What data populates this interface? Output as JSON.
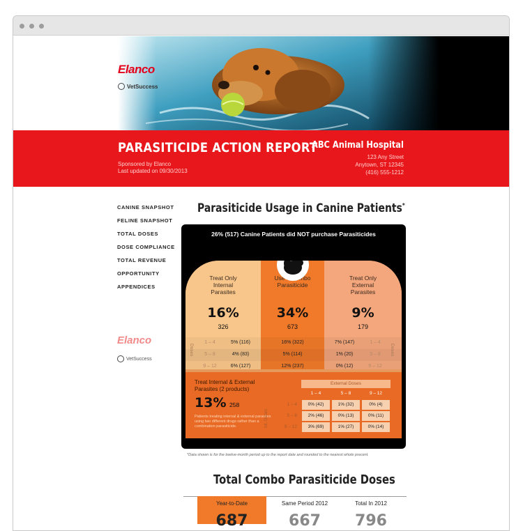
{
  "brand": {
    "elanco": "Elanco",
    "vetsuccess": "VetSuccess"
  },
  "header": {
    "title": "PARASITICIDE ACTION REPORT",
    "sponsor": "Sponsored by Elanco",
    "updated": "Last updated on 09/30/2013",
    "hospital": "ABC Animal Hospital",
    "address_line1": "123 Any Street",
    "address_line2": "Anytown, ST 12345",
    "phone": "(416) 555-1212"
  },
  "nav": {
    "items": [
      "CANINE SNAPSHOT",
      "FELINE SNAPSHOT",
      "TOTAL DOSES",
      "DOSE COMPLIANCE",
      "TOTAL REVENUE",
      "OPPORTUNITY",
      "APPENDICES"
    ]
  },
  "usage": {
    "title": "Parasiticide Usage in Canine Patients",
    "asterisk": "*",
    "headline": "26% (517) Canine Patients did NOT purchase Parasiticides",
    "columns": [
      {
        "label": "Treat Only Internal Parasites",
        "pct": "16%",
        "count": "326",
        "doses": [
          "5% (116)",
          "4% (83)",
          "6% (127)"
        ]
      },
      {
        "label": "Use a Combo Parasiticide",
        "pct": "34%",
        "count": "673",
        "doses": [
          "16% (322)",
          "5% (114)",
          "12% (237)"
        ]
      },
      {
        "label": "Treat Only External Parasites",
        "pct": "9%",
        "count": "179",
        "doses": [
          "7% (147)",
          "1% (20)",
          "0% (12)"
        ]
      }
    ],
    "dose_ranges": [
      "1 – 4",
      "5 – 8",
      "9 – 12"
    ],
    "doses_label": "Doses",
    "combo": {
      "title": "Treat Internal & External Parasites (2 products)",
      "pct": "13%",
      "count": "258",
      "note": "Patients treating internal & external parasites using two different drugs rather than a combination parasiticide.",
      "ext_doses_label": "External Doses",
      "int_doses_label": "Int. Doses",
      "grid": [
        [
          "0% (42)",
          "1% (32)",
          "0% (4)"
        ],
        [
          "2% (46)",
          "0% (13)",
          "0% (11)"
        ],
        [
          "3% (69)",
          "1% (27)",
          "0% (14)"
        ]
      ]
    },
    "footnote": "*Data shown is for the twelve-month period up to the report date and rounded to the nearest whole precent."
  },
  "combo_doses": {
    "title": "Total Combo Parasiticide Doses",
    "columns": [
      {
        "label": "Year-to-Date",
        "value": "687"
      },
      {
        "label": "Same Period 2012",
        "value": "667"
      },
      {
        "label": "Total In 2012",
        "value": "796"
      }
    ]
  },
  "colors": {
    "banner_red": "#e8171b",
    "internal": "#f8c68a",
    "combo": "#f07a2a",
    "external": "#f4a77c"
  }
}
